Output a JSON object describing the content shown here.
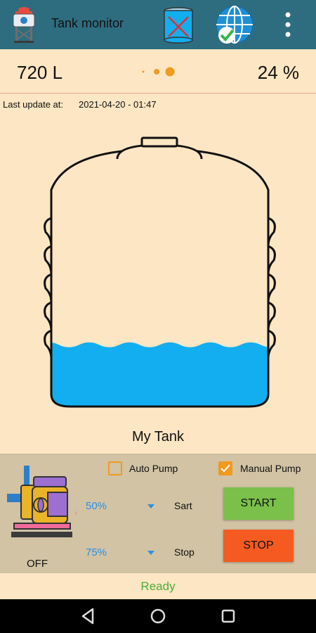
{
  "appbar": {
    "title": "Tank monitor",
    "icons": [
      "water-tower-icon",
      "tank-disconnected-icon",
      "network-connected-icon",
      "more-vert-icon"
    ]
  },
  "summary": {
    "volume": "720 L",
    "percent": "24 %",
    "fill_level": 0.24,
    "pager_dots": 3,
    "pager_active": 2
  },
  "update": {
    "label": "Last update at:",
    "value": "2021-04-20 - 01:47"
  },
  "tank": {
    "name": "My Tank",
    "water_color": "#12aef0"
  },
  "pump": {
    "state": "OFF",
    "auto_label": "Auto Pump",
    "auto_checked": false,
    "manual_label": "Manual Pump",
    "manual_checked": true,
    "start_value": "50%",
    "start_label": "Sart",
    "stop_value": "75%",
    "stop_label": "Stop",
    "start_button": "START",
    "stop_button": "STOP"
  },
  "status": {
    "text": "Ready"
  },
  "colors": {
    "appbar": "#2e6d80",
    "background": "#fde6c3",
    "panel": "#d1c3a4",
    "accent_orange": "#f09a1e",
    "start_green": "#7bc04a",
    "stop_red": "#f55a20",
    "ready_green": "#4cae3a"
  }
}
